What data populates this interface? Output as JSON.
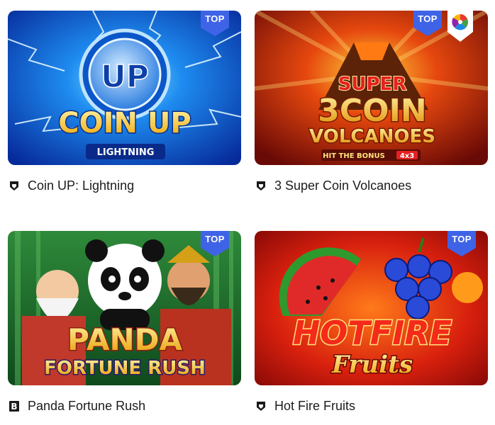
{
  "games": [
    {
      "title": "Coin UP: Lightning",
      "badge": "TOP",
      "provider_icon": "provider-shield-icon",
      "art_title": "COIN UP",
      "art_subtitle": "LIGHTNING",
      "art_emblem": "UP"
    },
    {
      "title": "3 Super Coin Volcanoes",
      "badge": "TOP",
      "provider_icon": "provider-shield-icon",
      "art_title_1": "SUPER",
      "art_title_2": "3COIN",
      "art_title_3": "VOLCANOES",
      "art_subtitle": "HIT THE BONUS",
      "art_tag": "4x3",
      "extra_badge_icon": "wheel-icon"
    },
    {
      "title": "Panda Fortune Rush",
      "badge": "TOP",
      "provider_icon": "provider-b-icon",
      "provider_letter": "B",
      "art_title_1": "PANDA",
      "art_title_2": "FORTUNE RUSH"
    },
    {
      "title": "Hot Fire Fruits",
      "badge": "TOP",
      "provider_icon": "provider-shield-icon",
      "art_title_1": "HOTFIRE",
      "art_title_2": "Fruits"
    }
  ],
  "colors": {
    "badge_blue": "#3f63e6",
    "title_text": "#1c1c1c"
  }
}
